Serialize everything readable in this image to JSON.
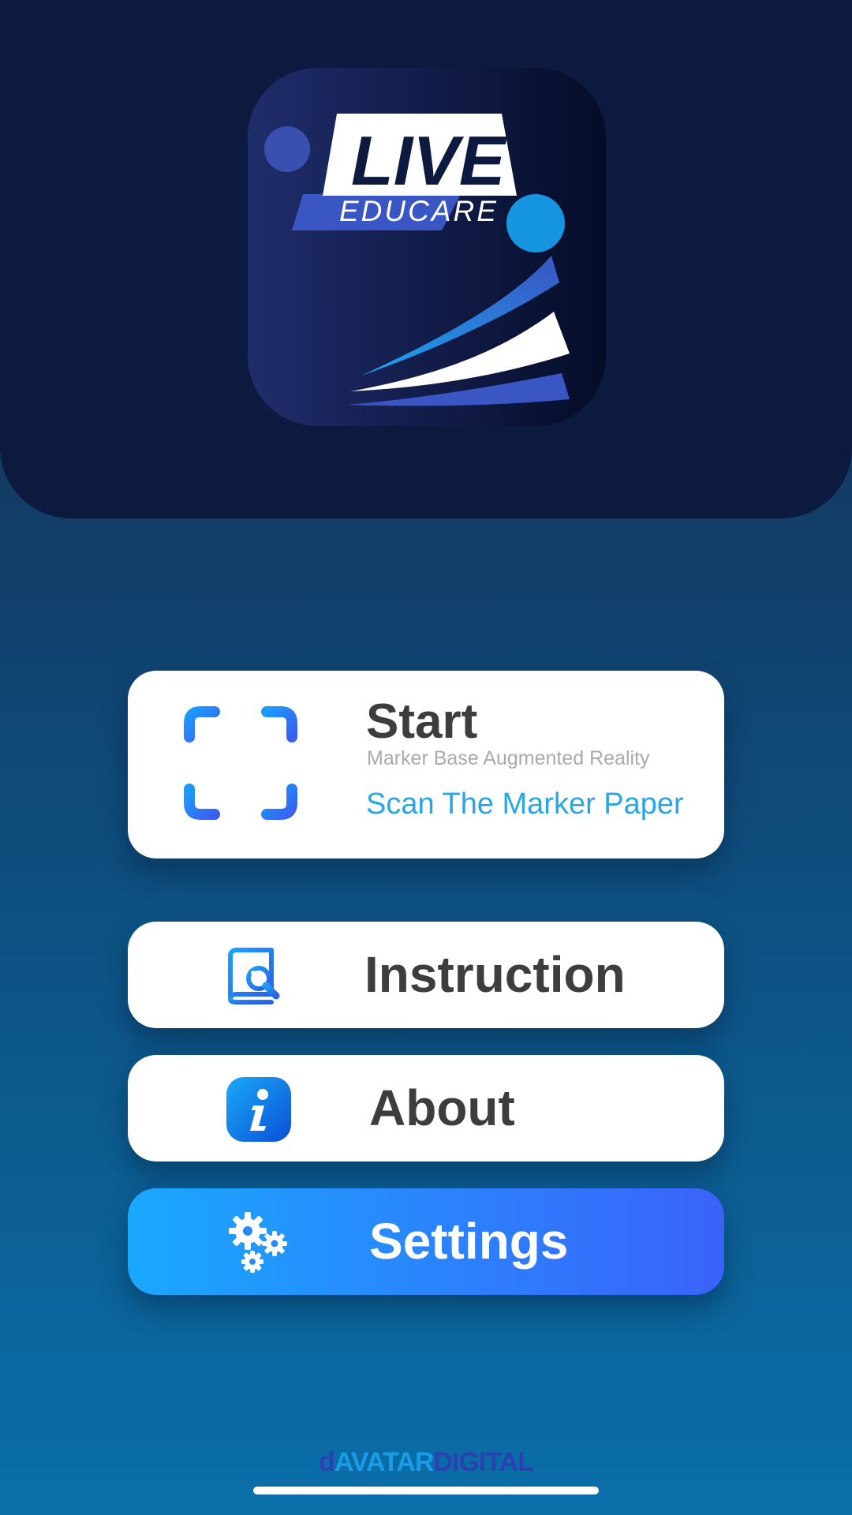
{
  "logo": {
    "word1": "LIVE",
    "word2": "EDUCARE"
  },
  "menu": {
    "start": {
      "title": "Start",
      "subtitle": "Marker Base Augmented Reality",
      "hint": "Scan The Marker Paper",
      "icon": "scan-icon"
    },
    "instruction": {
      "label": "Instruction",
      "icon": "book-wrench-icon"
    },
    "about": {
      "label": "About",
      "icon": "info-icon"
    },
    "settings": {
      "label": "Settings",
      "icon": "gears-icon"
    }
  },
  "footer": {
    "brand_mark": "d",
    "brand_word1": "AVATAR",
    "brand_word2": "DIGITAL"
  },
  "colors": {
    "header_bg": "#0d1a3f",
    "accent_blue": "#27a6ea",
    "settings_gradient_start": "#1aa8ff",
    "settings_gradient_end": "#3a62fa",
    "text_dark": "#3d3d3d"
  }
}
